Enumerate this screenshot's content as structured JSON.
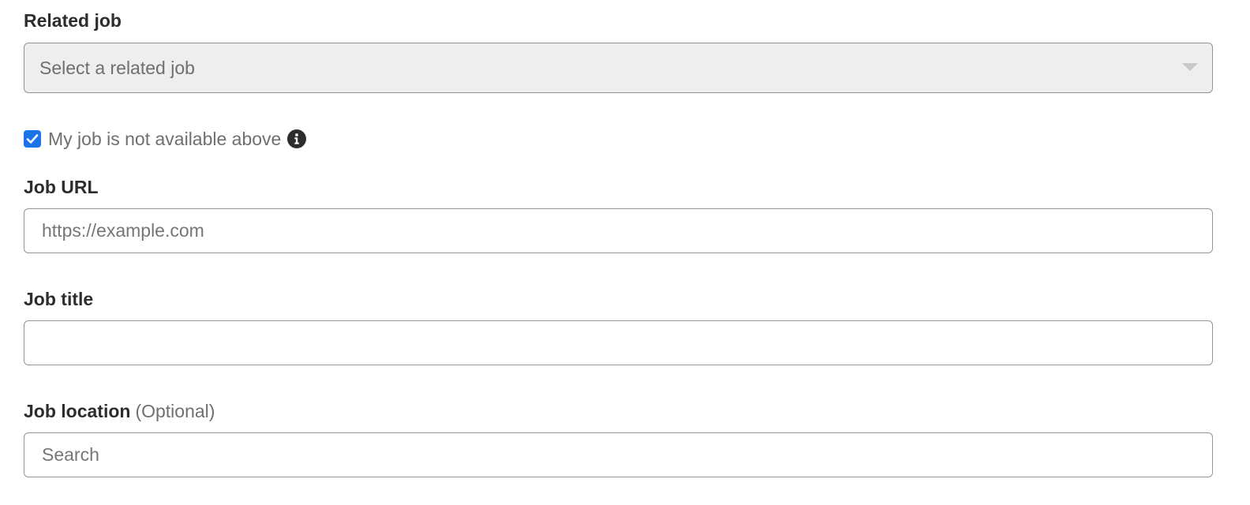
{
  "related_job": {
    "label": "Related job",
    "value": "Select a related job",
    "icon": "chevron-down-icon"
  },
  "not_available": {
    "checked": true,
    "label": "My job is not available above",
    "icon": "info-icon"
  },
  "job_url": {
    "label": "Job URL",
    "placeholder": "https://example.com",
    "value": ""
  },
  "job_title": {
    "label": "Job title",
    "placeholder": "",
    "value": ""
  },
  "job_location": {
    "label": "Job location",
    "optional_label": "(Optional)",
    "placeholder": "Search",
    "value": ""
  },
  "colors": {
    "accent": "#1a73e8",
    "text": "#2d2d2d",
    "muted": "#6f6f6f",
    "border": "#949494",
    "select_bg": "#eeeeee"
  }
}
